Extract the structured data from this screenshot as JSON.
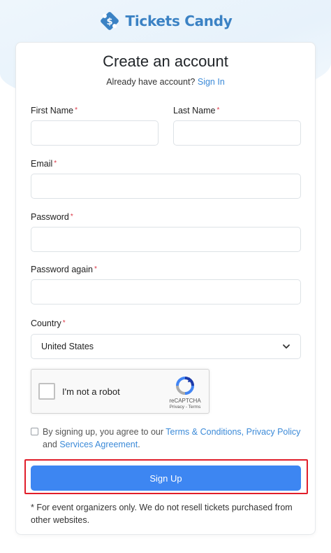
{
  "brand": {
    "name": "Tickets Candy",
    "icon": "ticket-icon",
    "color": "#3b82c4"
  },
  "form": {
    "title": "Create an account",
    "signin_prompt": "Already have account?",
    "signin_link": "Sign In",
    "first_name_label": "First Name",
    "last_name_label": "Last Name",
    "email_label": "Email",
    "password_label": "Password",
    "password_again_label": "Password again",
    "country_label": "Country",
    "country_value": "United States",
    "required_mark": "*"
  },
  "recaptcha": {
    "label": "I'm not a robot",
    "brand": "reCAPTCHA",
    "links": "Privacy - Terms"
  },
  "agreement": {
    "prefix": "By signing up, you agree to our",
    "terms": "Terms & Conditions,",
    "privacy": "Privacy Policy",
    "and": "and",
    "services": "Services Agreement",
    "suffix": "."
  },
  "submit_label": "Sign Up",
  "footnote": "* For event organizers only. We do not resell tickets purchased from other websites.",
  "colors": {
    "accent": "#3d86f2",
    "link": "#3b8ad8",
    "required": "#dc3545",
    "highlight": "#e11e2a"
  }
}
